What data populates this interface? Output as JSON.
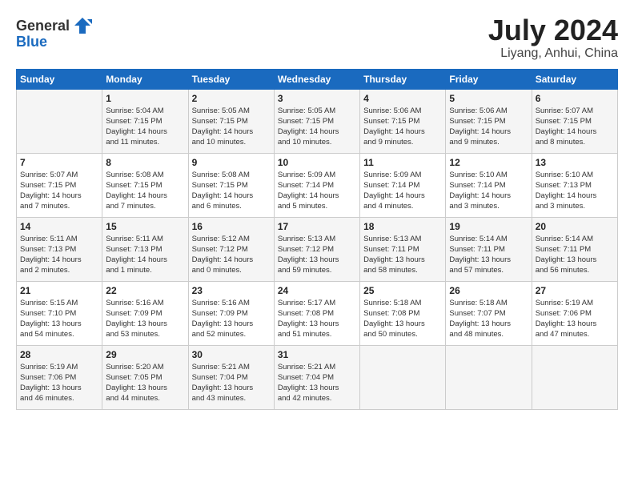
{
  "header": {
    "logo_general": "General",
    "logo_blue": "Blue",
    "month_title": "July 2024",
    "location": "Liyang, Anhui, China"
  },
  "days_of_week": [
    "Sunday",
    "Monday",
    "Tuesday",
    "Wednesday",
    "Thursday",
    "Friday",
    "Saturday"
  ],
  "weeks": [
    [
      {
        "day": "",
        "info": ""
      },
      {
        "day": "1",
        "info": "Sunrise: 5:04 AM\nSunset: 7:15 PM\nDaylight: 14 hours\nand 11 minutes."
      },
      {
        "day": "2",
        "info": "Sunrise: 5:05 AM\nSunset: 7:15 PM\nDaylight: 14 hours\nand 10 minutes."
      },
      {
        "day": "3",
        "info": "Sunrise: 5:05 AM\nSunset: 7:15 PM\nDaylight: 14 hours\nand 10 minutes."
      },
      {
        "day": "4",
        "info": "Sunrise: 5:06 AM\nSunset: 7:15 PM\nDaylight: 14 hours\nand 9 minutes."
      },
      {
        "day": "5",
        "info": "Sunrise: 5:06 AM\nSunset: 7:15 PM\nDaylight: 14 hours\nand 9 minutes."
      },
      {
        "day": "6",
        "info": "Sunrise: 5:07 AM\nSunset: 7:15 PM\nDaylight: 14 hours\nand 8 minutes."
      }
    ],
    [
      {
        "day": "7",
        "info": "Sunrise: 5:07 AM\nSunset: 7:15 PM\nDaylight: 14 hours\nand 7 minutes."
      },
      {
        "day": "8",
        "info": "Sunrise: 5:08 AM\nSunset: 7:15 PM\nDaylight: 14 hours\nand 7 minutes."
      },
      {
        "day": "9",
        "info": "Sunrise: 5:08 AM\nSunset: 7:15 PM\nDaylight: 14 hours\nand 6 minutes."
      },
      {
        "day": "10",
        "info": "Sunrise: 5:09 AM\nSunset: 7:14 PM\nDaylight: 14 hours\nand 5 minutes."
      },
      {
        "day": "11",
        "info": "Sunrise: 5:09 AM\nSunset: 7:14 PM\nDaylight: 14 hours\nand 4 minutes."
      },
      {
        "day": "12",
        "info": "Sunrise: 5:10 AM\nSunset: 7:14 PM\nDaylight: 14 hours\nand 3 minutes."
      },
      {
        "day": "13",
        "info": "Sunrise: 5:10 AM\nSunset: 7:13 PM\nDaylight: 14 hours\nand 3 minutes."
      }
    ],
    [
      {
        "day": "14",
        "info": "Sunrise: 5:11 AM\nSunset: 7:13 PM\nDaylight: 14 hours\nand 2 minutes."
      },
      {
        "day": "15",
        "info": "Sunrise: 5:11 AM\nSunset: 7:13 PM\nDaylight: 14 hours\nand 1 minute."
      },
      {
        "day": "16",
        "info": "Sunrise: 5:12 AM\nSunset: 7:12 PM\nDaylight: 14 hours\nand 0 minutes."
      },
      {
        "day": "17",
        "info": "Sunrise: 5:13 AM\nSunset: 7:12 PM\nDaylight: 13 hours\nand 59 minutes."
      },
      {
        "day": "18",
        "info": "Sunrise: 5:13 AM\nSunset: 7:11 PM\nDaylight: 13 hours\nand 58 minutes."
      },
      {
        "day": "19",
        "info": "Sunrise: 5:14 AM\nSunset: 7:11 PM\nDaylight: 13 hours\nand 57 minutes."
      },
      {
        "day": "20",
        "info": "Sunrise: 5:14 AM\nSunset: 7:11 PM\nDaylight: 13 hours\nand 56 minutes."
      }
    ],
    [
      {
        "day": "21",
        "info": "Sunrise: 5:15 AM\nSunset: 7:10 PM\nDaylight: 13 hours\nand 54 minutes."
      },
      {
        "day": "22",
        "info": "Sunrise: 5:16 AM\nSunset: 7:09 PM\nDaylight: 13 hours\nand 53 minutes."
      },
      {
        "day": "23",
        "info": "Sunrise: 5:16 AM\nSunset: 7:09 PM\nDaylight: 13 hours\nand 52 minutes."
      },
      {
        "day": "24",
        "info": "Sunrise: 5:17 AM\nSunset: 7:08 PM\nDaylight: 13 hours\nand 51 minutes."
      },
      {
        "day": "25",
        "info": "Sunrise: 5:18 AM\nSunset: 7:08 PM\nDaylight: 13 hours\nand 50 minutes."
      },
      {
        "day": "26",
        "info": "Sunrise: 5:18 AM\nSunset: 7:07 PM\nDaylight: 13 hours\nand 48 minutes."
      },
      {
        "day": "27",
        "info": "Sunrise: 5:19 AM\nSunset: 7:06 PM\nDaylight: 13 hours\nand 47 minutes."
      }
    ],
    [
      {
        "day": "28",
        "info": "Sunrise: 5:19 AM\nSunset: 7:06 PM\nDaylight: 13 hours\nand 46 minutes."
      },
      {
        "day": "29",
        "info": "Sunrise: 5:20 AM\nSunset: 7:05 PM\nDaylight: 13 hours\nand 44 minutes."
      },
      {
        "day": "30",
        "info": "Sunrise: 5:21 AM\nSunset: 7:04 PM\nDaylight: 13 hours\nand 43 minutes."
      },
      {
        "day": "31",
        "info": "Sunrise: 5:21 AM\nSunset: 7:04 PM\nDaylight: 13 hours\nand 42 minutes."
      },
      {
        "day": "",
        "info": ""
      },
      {
        "day": "",
        "info": ""
      },
      {
        "day": "",
        "info": ""
      }
    ]
  ]
}
